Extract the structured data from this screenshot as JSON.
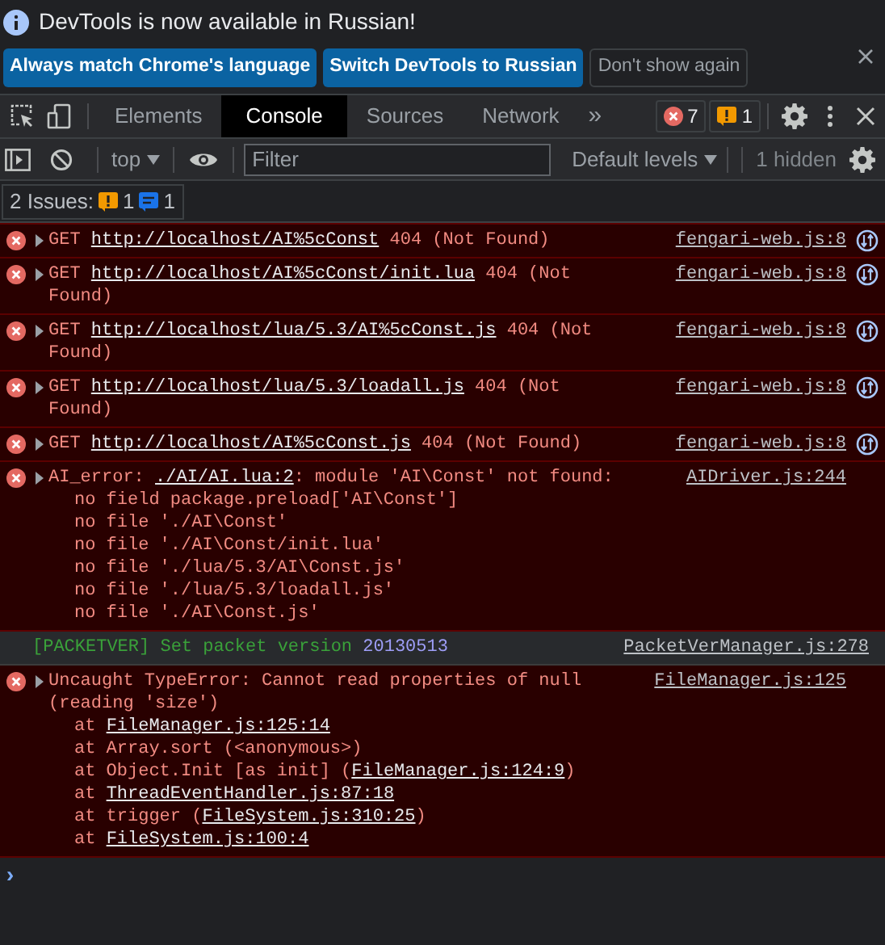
{
  "infobar": {
    "message": "DevTools is now available in Russian!",
    "buttons": [
      {
        "label": "Always match Chrome's language",
        "kind": "primary"
      },
      {
        "label": "Switch DevTools to Russian",
        "kind": "primary"
      },
      {
        "label": "Don't show again",
        "kind": "secondary"
      }
    ]
  },
  "tabs": [
    {
      "label": "Elements",
      "selected": false
    },
    {
      "label": "Console",
      "selected": true
    },
    {
      "label": "Sources",
      "selected": false
    },
    {
      "label": "Network",
      "selected": false
    }
  ],
  "more_tabs": "»",
  "counts": {
    "errors": "7",
    "warnings": "1"
  },
  "toolbar": {
    "context": "top",
    "filter_placeholder": "Filter",
    "levels": "Default levels",
    "hidden": "1 hidden"
  },
  "issues": {
    "label": "2 Issues:",
    "warnings": "1",
    "infos": "1"
  },
  "messages": [
    {
      "kind": "network",
      "segments": [
        {
          "text": "GET "
        },
        {
          "text": "http://localhost/AI%5cConst",
          "link": true
        },
        {
          "text": " 404 (Not Found)"
        }
      ],
      "source": "fengari-web.js:8"
    },
    {
      "kind": "network",
      "segments": [
        {
          "text": "GET "
        },
        {
          "text": "http://localhost/AI%5cConst/init.lua",
          "link": true
        },
        {
          "text": " 404 (Not Found)"
        }
      ],
      "source": "fengari-web.js:8"
    },
    {
      "kind": "network",
      "segments": [
        {
          "text": "GET "
        },
        {
          "text": "http://localhost/lua/5.3/AI%5cConst.js",
          "link": true
        },
        {
          "text": " 404 (Not Found)"
        }
      ],
      "source": "fengari-web.js:8"
    },
    {
      "kind": "network",
      "segments": [
        {
          "text": "GET "
        },
        {
          "text": "http://localhost/lua/5.3/loadall.js",
          "link": true
        },
        {
          "text": " 404 (Not Found)"
        }
      ],
      "source": "fengari-web.js:8"
    },
    {
      "kind": "network",
      "segments": [
        {
          "text": "GET "
        },
        {
          "text": "http://localhost/AI%5cConst.js",
          "link": true
        },
        {
          "text": " 404 (Not Found)"
        }
      ],
      "source": "fengari-web.js:8"
    },
    {
      "kind": "error",
      "segments": [
        {
          "text": "AI_error:  "
        },
        {
          "text": "./AI/AI.lua:2",
          "link": true
        },
        {
          "text": ": module 'AI\\Const' not found:"
        }
      ],
      "source": "AIDriver.js:244",
      "lines": [
        [
          {
            "text": "no field package.preload['AI\\Const']"
          }
        ],
        [
          {
            "text": "no file './AI\\Const'"
          }
        ],
        [
          {
            "text": "no file './AI\\Const/init.lua'"
          }
        ],
        [
          {
            "text": "no file './lua/5.3/AI\\Const.js'"
          }
        ],
        [
          {
            "text": "no file './lua/5.3/loadall.js'"
          }
        ],
        [
          {
            "text": "no file './AI\\Const.js'"
          }
        ]
      ]
    },
    {
      "kind": "info",
      "segments": [
        {
          "text": "[PACKETVER] Set packet version  "
        },
        {
          "text": "20130513",
          "number": true
        }
      ],
      "source": "PacketVerManager.js:278"
    },
    {
      "kind": "error",
      "segments": [
        {
          "text": "Uncaught TypeError: Cannot read properties of null (reading 'size')"
        }
      ],
      "source": "FileManager.js:125",
      "lines": [
        [
          {
            "text": "at "
          },
          {
            "text": "FileManager.js:125:14",
            "link": true
          }
        ],
        [
          {
            "text": "at Array.sort (<anonymous>)"
          }
        ],
        [
          {
            "text": "at Object.Init [as init] ("
          },
          {
            "text": "FileManager.js:124:9",
            "link": true
          },
          {
            "text": ")"
          }
        ],
        [
          {
            "text": "at "
          },
          {
            "text": "ThreadEventHandler.js:87:18",
            "link": true
          }
        ],
        [
          {
            "text": "at trigger ("
          },
          {
            "text": "FileSystem.js:310:25",
            "link": true
          },
          {
            "text": ")"
          }
        ],
        [
          {
            "text": "at "
          },
          {
            "text": "FileSystem.js:100:4",
            "link": true
          }
        ]
      ]
    }
  ],
  "prompt": "›"
}
